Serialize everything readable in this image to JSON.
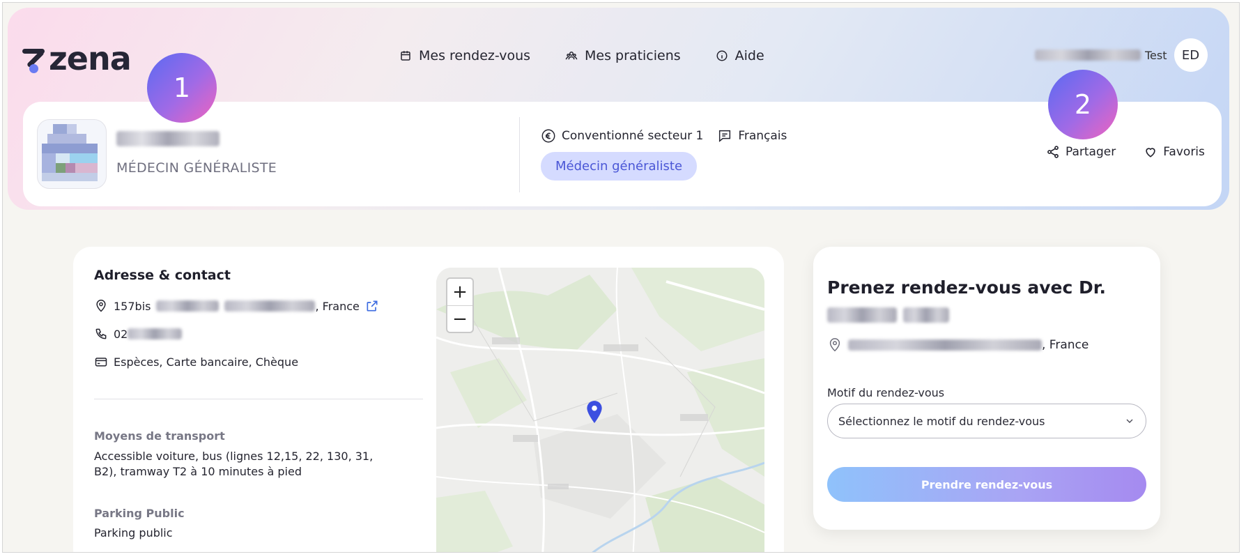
{
  "brand": {
    "name": "zena"
  },
  "nav": {
    "items": [
      {
        "label": "Mes rendez-vous",
        "icon": "calendar-icon"
      },
      {
        "label": "Mes praticiens",
        "icon": "people-icon"
      },
      {
        "label": "Aide",
        "icon": "info-icon"
      }
    ]
  },
  "user": {
    "last_name": "Test",
    "initials": "ED"
  },
  "step_badges": [
    "1",
    "2"
  ],
  "doctor": {
    "specialty_caps": "MÉDECIN GÉNÉRALISTE",
    "convention": "Conventionné secteur 1",
    "language": "Français",
    "specialty_tag": "Médecin généraliste"
  },
  "actions": {
    "share": "Partager",
    "favorites": "Favoris"
  },
  "contact": {
    "title": "Adresse & contact",
    "address_prefix": "157bis",
    "address_suffix": ", France",
    "phone_prefix": "02",
    "payments": "Espèces, Carte bancaire, Chèque",
    "transport_label": "Moyens de transport",
    "transport_text": "Accessible voiture, bus (lignes 12,15, 22, 130, 31, B2), tramway T2 à 10 minutes à pied",
    "parking_label": "Parking Public",
    "parking_text": "Parking public"
  },
  "map": {
    "zoom_in": "+",
    "zoom_out": "−",
    "pin_color": "#3c4fe0"
  },
  "booking": {
    "title_prefix": "Prenez rendez-vous avec Dr.",
    "address_suffix": ", France",
    "motif_label": "Motif du rendez-vous",
    "motif_placeholder": "Sélectionnez le motif du rendez-vous",
    "submit": "Prendre rendez-vous"
  },
  "colors": {
    "accent": "#4a56d6",
    "pill_bg": "#d5dbff",
    "badge_from": "#5a6af2",
    "badge_to": "#f064be"
  }
}
